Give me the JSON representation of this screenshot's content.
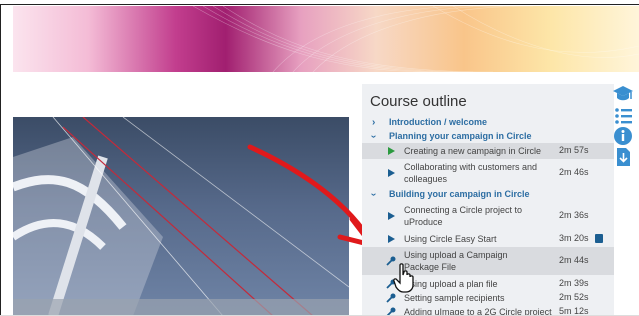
{
  "outline": {
    "title": "Course outline",
    "items": [
      {
        "type": "section",
        "label": "Introduction / welcome",
        "expanded": false
      },
      {
        "type": "section",
        "label": "Planning your campaign in Circle",
        "expanded": true
      },
      {
        "type": "lesson",
        "label": "Creating a new campaign in Circle",
        "duration": "2m 57s",
        "icon": "play-icon",
        "state": "watched"
      },
      {
        "type": "lesson",
        "label": "Collaborating with customers and colleagues",
        "duration": "2m 46s",
        "icon": "play-icon",
        "state": "default"
      },
      {
        "type": "section",
        "label": "Building your campaign in Circle",
        "expanded": true
      },
      {
        "type": "lesson",
        "label": "Connecting a Circle project to uProduce",
        "duration": "2m 36s",
        "icon": "play-icon",
        "state": "default"
      },
      {
        "type": "lesson",
        "label": "Using Circle Easy Start",
        "duration": "3m 20s",
        "icon": "play-icon",
        "state": "default"
      },
      {
        "type": "lesson",
        "label": "Using upload a Campaign Package File",
        "duration": "2m 44s",
        "icon": "key-icon",
        "state": "hover"
      },
      {
        "type": "lesson",
        "label": "Using upload a plan file",
        "duration": "2m 39s",
        "icon": "key-icon",
        "state": "default"
      },
      {
        "type": "lesson",
        "label": "Setting sample recipients",
        "duration": "2m 52s",
        "icon": "key-icon",
        "state": "default"
      },
      {
        "type": "lesson",
        "label": "Adding uImage to a 2G Circle project",
        "duration": "5m 12s",
        "icon": "key-icon",
        "state": "default"
      }
    ]
  },
  "sidebar_icons": [
    "graduation-cap-icon",
    "list-icon",
    "info-icon",
    "download-icon"
  ],
  "colors": {
    "accent": "#2d6ea3",
    "play": "#1b5e91",
    "watched": "#2b9a3f",
    "annotation": "#e0191b"
  }
}
